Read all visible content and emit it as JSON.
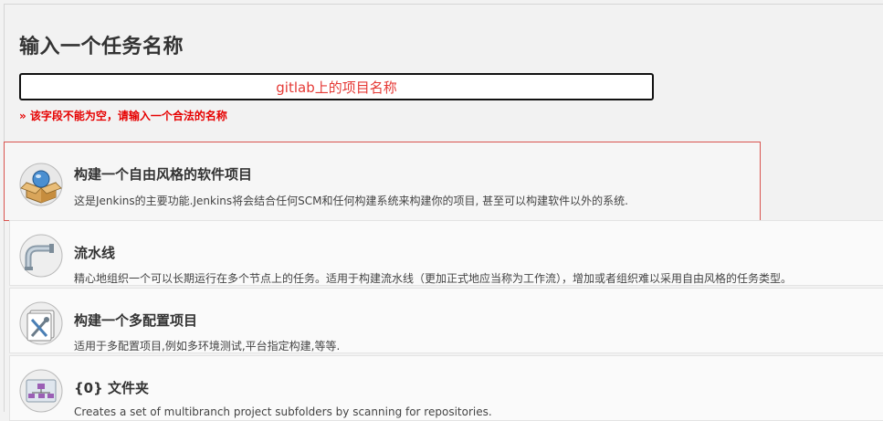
{
  "page": {
    "title": "输入一个任务名称"
  },
  "name_input": {
    "value": "gitlab上的项目名称"
  },
  "validation_error": "» 该字段不能为空，请输入一个合法的名称",
  "job_types": [
    {
      "label": "构建一个自由风格的软件项目",
      "description": "这是Jenkins的主要功能.Jenkins将会结合任何SCM和任何构建系统来构建你的项目, 甚至可以构建软件以外的系统.",
      "icon": "freestyle-box-icon",
      "selected": true
    },
    {
      "label": "流水线",
      "description": "精心地组织一个可以长期运行在多个节点上的任务。适用于构建流水线（更加正式地应当称为工作流），增加或者组织难以采用自由风格的任务类型。",
      "icon": "pipeline-icon",
      "selected": false
    },
    {
      "label": "构建一个多配置项目",
      "description": "适用于多配置项目,例如多环境测试,平台指定构建,等等.",
      "icon": "multi-config-tools-icon",
      "selected": false
    },
    {
      "label": "{0} 文件夹",
      "description": "Creates a set of multibranch project subfolders by scanning for repositories.",
      "icon": "folder-org-icon",
      "selected": false
    }
  ],
  "colors": {
    "error": "#e60000",
    "input_text": "#e53935",
    "selected_border": "#d9534f",
    "background": "#f2f2f2"
  }
}
